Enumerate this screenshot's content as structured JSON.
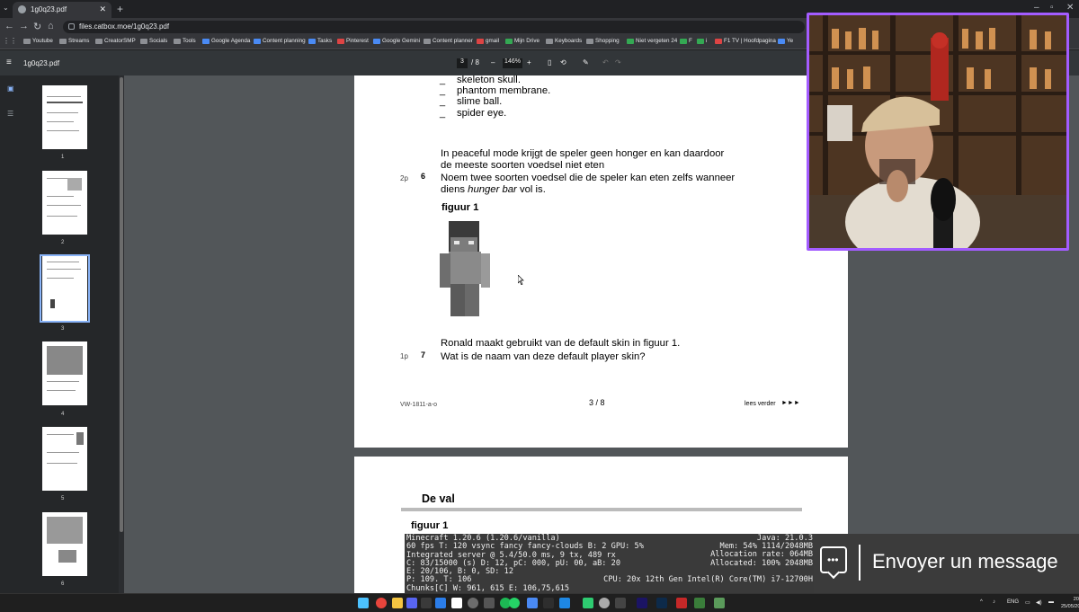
{
  "browser": {
    "tab_title": "1g0q23.pdf",
    "url": "files.catbox.moe/1g0q23.pdf",
    "bookmarks": [
      "Youtube",
      "Streams",
      "CreatorSMP",
      "Socials",
      "Tools",
      "Google Agenda",
      "Content planning",
      "Tasks",
      "Pinterest",
      "Google Gemini",
      "Content planner",
      "gmail",
      "Mijn Drive",
      "Keyboards",
      "Shopping",
      "Niet vergeten 24",
      "F",
      "i",
      "F1 TV | Hoofdpagina",
      "Ye"
    ]
  },
  "pdf_toolbar": {
    "title": "1g0q23.pdf",
    "current_page": "3",
    "total_pages": "/ 8",
    "zoom": "146%"
  },
  "thumbnails": [
    "1",
    "2",
    "3",
    "4",
    "5",
    "6"
  ],
  "page3": {
    "bullets": [
      "skeleton skull.",
      "phantom membrane.",
      "slime ball.",
      "spider eye."
    ],
    "bullet_mark": "_",
    "intro_line1": "In peaceful mode krijgt de speler geen honger en kan daardoor",
    "intro_line2": "de meeste soorten voedsel niet eten",
    "q6_points": "2p",
    "q6_number": "6",
    "q6_line1": "Noem twee soorten voedsel die de speler kan eten zelfs wanneer",
    "q6_line2_pre": "diens ",
    "q6_line2_em": "hunger bar",
    "q6_line2_post": " vol is.",
    "figure_label": "figuur 1",
    "q7_intro": "Ronald maakt gebruikt van de default skin in figuur 1.",
    "q7_points": "1p",
    "q7_number": "7",
    "q7_text": "Wat is de naam van deze default player skin?",
    "footer_code": "VW-1811-a-o",
    "footer_page": "3 / 8",
    "footer_next": "lees verder",
    "footer_arrows": "►►►"
  },
  "page4": {
    "heading": "De val",
    "figure_label": "figuur 1",
    "debug_left": [
      "Minecraft 1.20.6 (1.20.6/vanilla)",
      "60 fps T: 120 vsync fancy fancy-clouds B: 2 GPU: 5%",
      "Integrated server @ 5.4/50.0 ms, 9 tx, 489 rx",
      "C: 83/15000 (s) D: 12, pC: 000, pU: 00, aB: 20",
      "E: 20/106, B: 0, SD: 12",
      "P: 109. T: 106",
      "Chunks[C] W: 961, 615 E: 106,75,615"
    ],
    "debug_right": [
      "Java: 21.0.3",
      "Mem: 54% 1114/2048MB",
      "Allocation rate: 064MB",
      "Allocated: 100% 2048MB",
      "",
      "CPU: 20x 12th Gen Intel(R) Core(TM) i7-12700H"
    ]
  },
  "chat": {
    "text": "Envoyer un message"
  },
  "taskbar": {
    "lang": "ENG",
    "time": "20:28",
    "date": "25/05/2026"
  }
}
